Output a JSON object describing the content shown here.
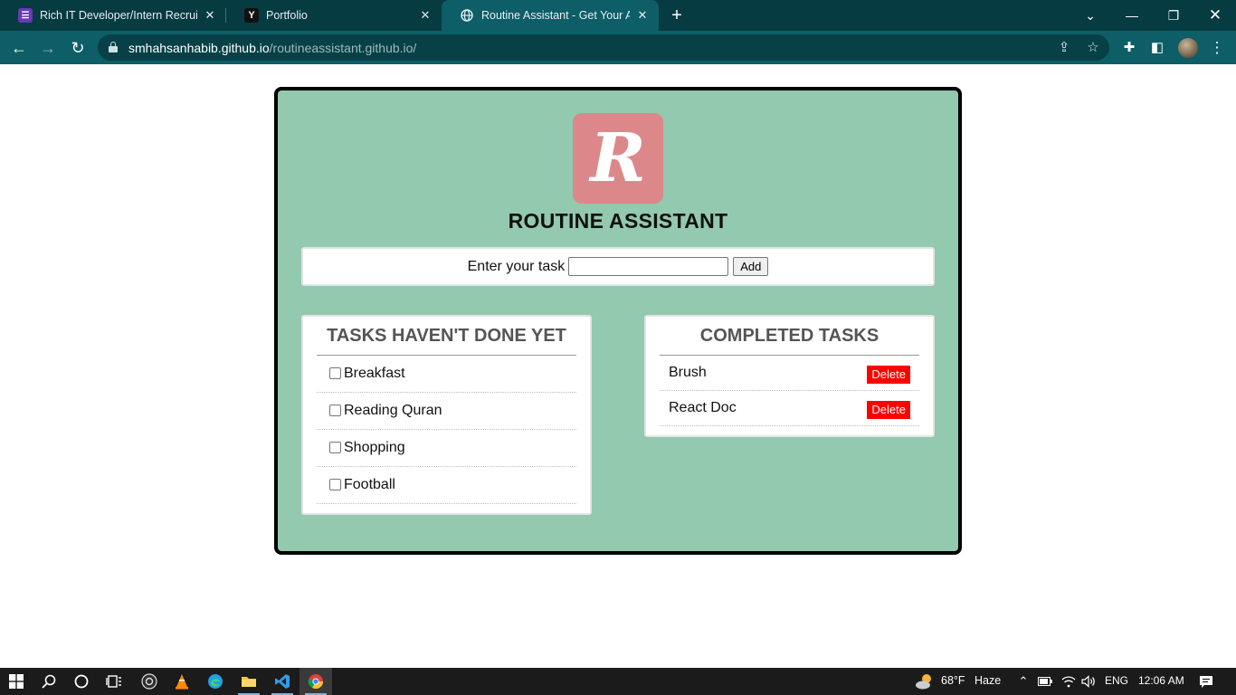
{
  "browser": {
    "tabs": [
      {
        "title": "Rich IT Developer/Intern Recruitment",
        "favicon": "form-icon",
        "favicon_color": "#673ab7",
        "active": false
      },
      {
        "title": "Portfolio",
        "favicon": "Y",
        "favicon_color": "#111111",
        "active": false
      },
      {
        "title": "Routine Assistant - Get Your All Work Done",
        "favicon": "globe-icon",
        "favicon_color": "#e6eef0",
        "active": true
      }
    ],
    "new_tab": "+",
    "url_host": "smhahsanhabib.github.io",
    "url_path": "/routineassistant.github.io/",
    "colors": {
      "tabbar": "#063b41",
      "toolbar": "#0d5e66",
      "omnibox": "#074147"
    }
  },
  "page": {
    "logo_letter": "R",
    "logo_color": "#dc888a",
    "background_color": "#93c9ae",
    "title": "ROUTINE ASSISTANT",
    "task_entry": {
      "label": "Enter your task",
      "value": "",
      "add_label": "Add"
    },
    "pending": {
      "heading": "TASKS HAVEN'T DONE YET",
      "items": [
        {
          "label": "Breakfast",
          "checked": false
        },
        {
          "label": "Reading Quran",
          "checked": false
        },
        {
          "label": "Shopping",
          "checked": false
        },
        {
          "label": "Football",
          "checked": false
        }
      ]
    },
    "completed": {
      "heading": "COMPLETED TASKS",
      "delete_label": "Delete",
      "delete_color": "#ff0000",
      "items": [
        {
          "label": "Brush"
        },
        {
          "label": "React Doc"
        }
      ]
    }
  },
  "taskbar": {
    "pinned": [
      "windows-start-icon",
      "search-icon",
      "cortana-icon",
      "task-view-icon",
      "obs-icon",
      "vlc-icon",
      "edge-icon",
      "file-explorer-icon",
      "vscode-icon",
      "chrome-icon"
    ],
    "weather_temp": "68°F",
    "weather_text": "Haze",
    "language": "ENG",
    "time": "12:06 AM"
  }
}
